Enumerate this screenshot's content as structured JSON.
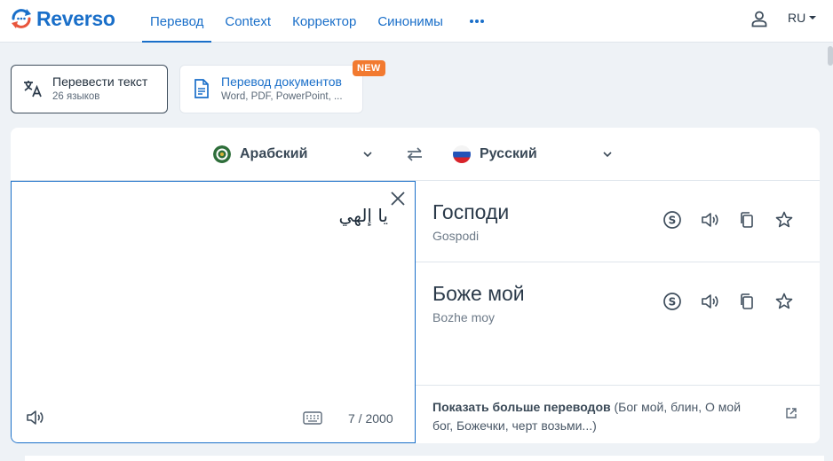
{
  "header": {
    "logo_text": "Reverso",
    "nav": [
      {
        "label": "Перевод",
        "active": true
      },
      {
        "label": "Context",
        "active": false
      },
      {
        "label": "Корректор",
        "active": false
      },
      {
        "label": "Синонимы",
        "active": false
      }
    ],
    "more_icon": "more-dots-icon",
    "user_icon": "user-icon",
    "ui_language": "RU"
  },
  "modes": {
    "text": {
      "title": "Перевести текст",
      "subtitle": "26 языков",
      "icon": "translate-icon"
    },
    "documents": {
      "title": "Перевод документов",
      "subtitle": "Word, PDF, PowerPoint, ...",
      "icon": "document-icon",
      "badge": "NEW"
    }
  },
  "languages": {
    "source": {
      "name": "Арабский"
    },
    "target": {
      "name": "Русский"
    }
  },
  "source": {
    "text": "يا إلهي",
    "counter": "7 / 2000"
  },
  "results": [
    {
      "word": "Господи",
      "translit": "Gospodi"
    },
    {
      "word": "Боже мой",
      "translit": "Bozhe moy"
    }
  ],
  "more_translations": {
    "label": "Показать больше переводов",
    "list": " (Бог мой, блин, О мой бог, Божечки, черт возьми...)"
  },
  "colors": {
    "brand": "#1a6fc9",
    "badge": "#f27a30",
    "background": "#eef2f6"
  }
}
